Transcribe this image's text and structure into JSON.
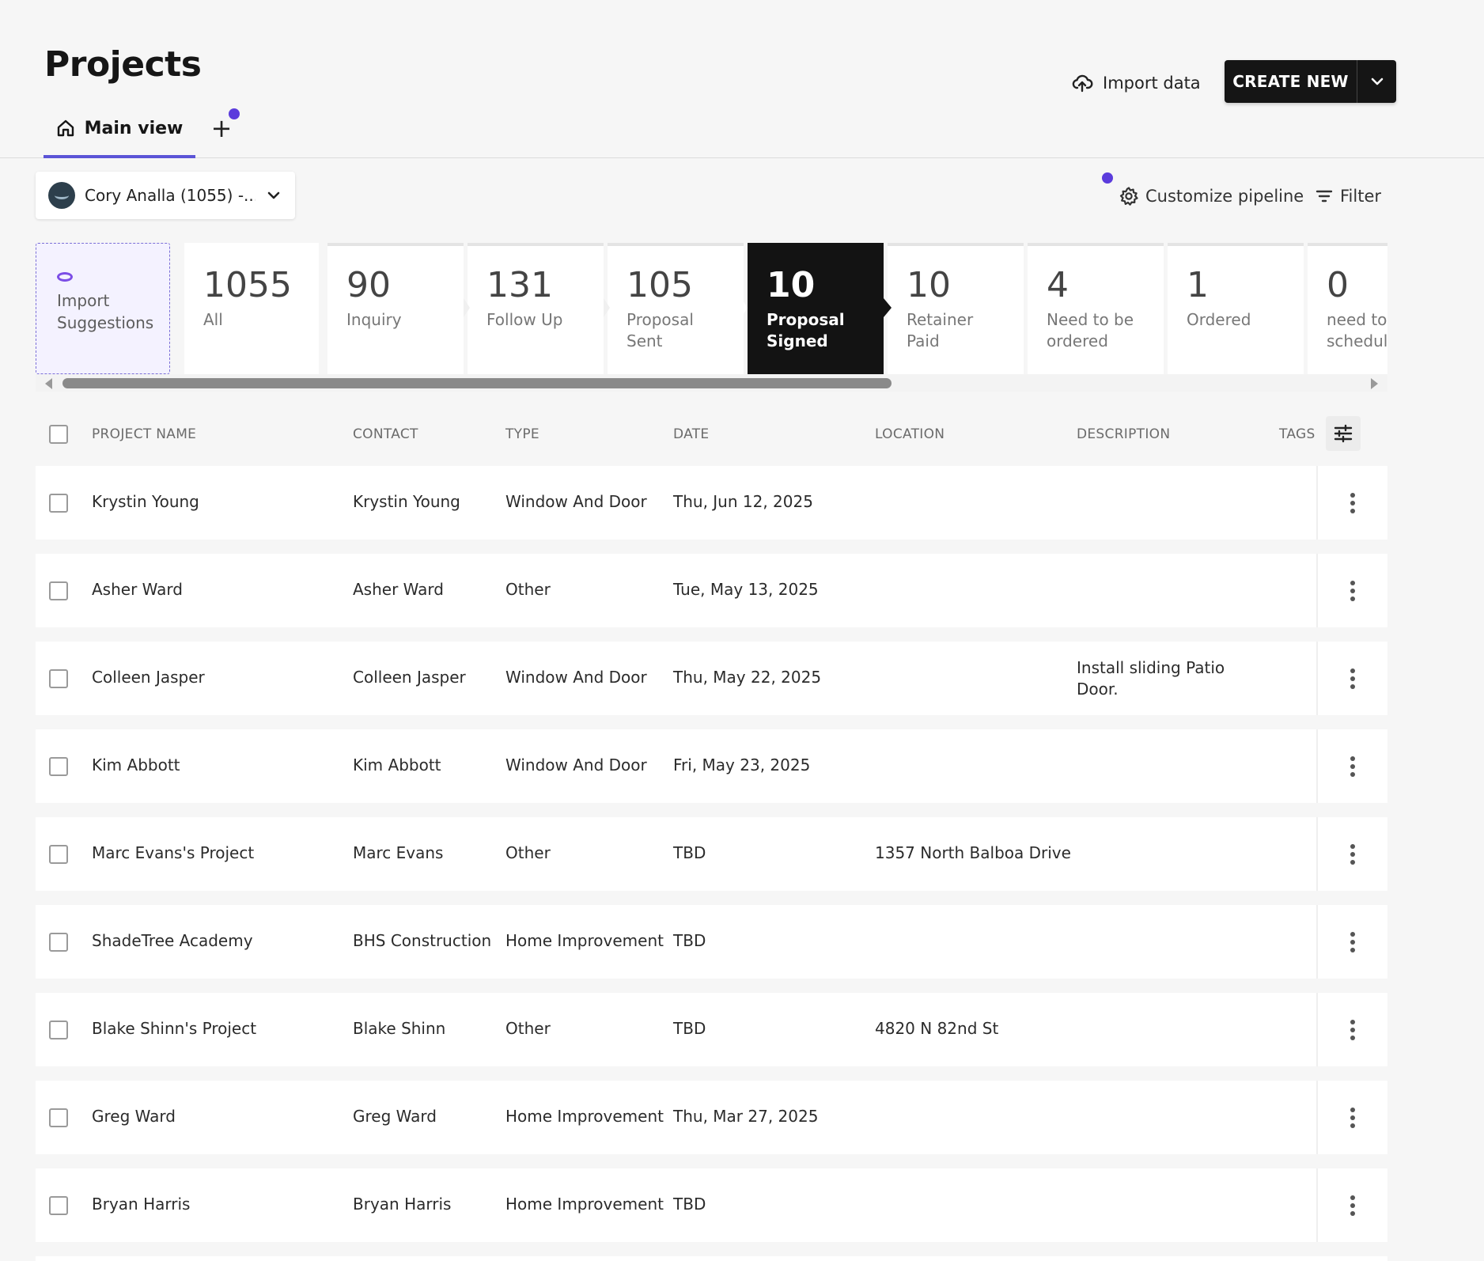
{
  "header": {
    "title": "Projects",
    "tab_main": "Main view",
    "tab_add": "+",
    "import_data": "Import data",
    "create_new": "CREATE NEW"
  },
  "toolbar": {
    "account": "Cory Analla (1055) -...",
    "customize": "Customize pipeline",
    "filter": "Filter"
  },
  "pipeline": {
    "import_suggestions": "Import\nSuggestions",
    "stages": [
      {
        "count": "1055",
        "label": "All"
      },
      {
        "count": "90",
        "label": "Inquiry"
      },
      {
        "count": "131",
        "label": "Follow Up"
      },
      {
        "count": "105",
        "label": "Proposal\nSent"
      },
      {
        "count": "10",
        "label": "Proposal\nSigned"
      },
      {
        "count": "10",
        "label": "Retainer Paid"
      },
      {
        "count": "4",
        "label": "Need to be\nordered"
      },
      {
        "count": "1",
        "label": "Ordered"
      },
      {
        "count": "0",
        "label": "need to\nschedule"
      }
    ],
    "active_stage": "Proposal Signed"
  },
  "table": {
    "columns": [
      "PROJECT NAME",
      "CONTACT",
      "TYPE",
      "DATE",
      "LOCATION",
      "DESCRIPTION",
      "TAGS"
    ],
    "rows": [
      {
        "name": "Krystin Young",
        "contact": "Krystin Young",
        "type": "Window And Door",
        "date": "Thu, Jun 12, 2025",
        "location": "",
        "description": ""
      },
      {
        "name": "Asher Ward",
        "contact": "Asher Ward",
        "type": "Other",
        "date": "Tue, May 13, 2025",
        "location": "",
        "description": ""
      },
      {
        "name": "Colleen Jasper",
        "contact": "Colleen Jasper",
        "type": "Window And Door",
        "date": "Thu, May 22, 2025",
        "location": "",
        "description": "Install sliding Patio Door."
      },
      {
        "name": "Kim Abbott",
        "contact": "Kim Abbott",
        "type": "Window And Door",
        "date": "Fri, May 23, 2025",
        "location": "",
        "description": ""
      },
      {
        "name": "Marc Evans's Project",
        "contact": "Marc Evans",
        "type": "Other",
        "date": "TBD",
        "location": "1357 North Balboa Drive",
        "description": ""
      },
      {
        "name": "ShadeTree Academy",
        "contact": "BHS Construction",
        "type": "Home Improvement",
        "date": "TBD",
        "location": "",
        "description": ""
      },
      {
        "name": "Blake Shinn's Project",
        "contact": "Blake Shinn",
        "type": "Other",
        "date": "TBD",
        "location": "4820 N 82nd St",
        "description": ""
      },
      {
        "name": "Greg Ward",
        "contact": "Greg Ward",
        "type": "Home Improvement",
        "date": "Thu, Mar 27, 2025",
        "location": "",
        "description": ""
      },
      {
        "name": "Bryan Harris",
        "contact": "Bryan Harris",
        "type": "Home Improvement",
        "date": "TBD",
        "location": "",
        "description": ""
      }
    ]
  },
  "colors": {
    "accent": "#5b54d6",
    "notification_dot": "#5b3cdc",
    "primary_button": "#151515"
  }
}
